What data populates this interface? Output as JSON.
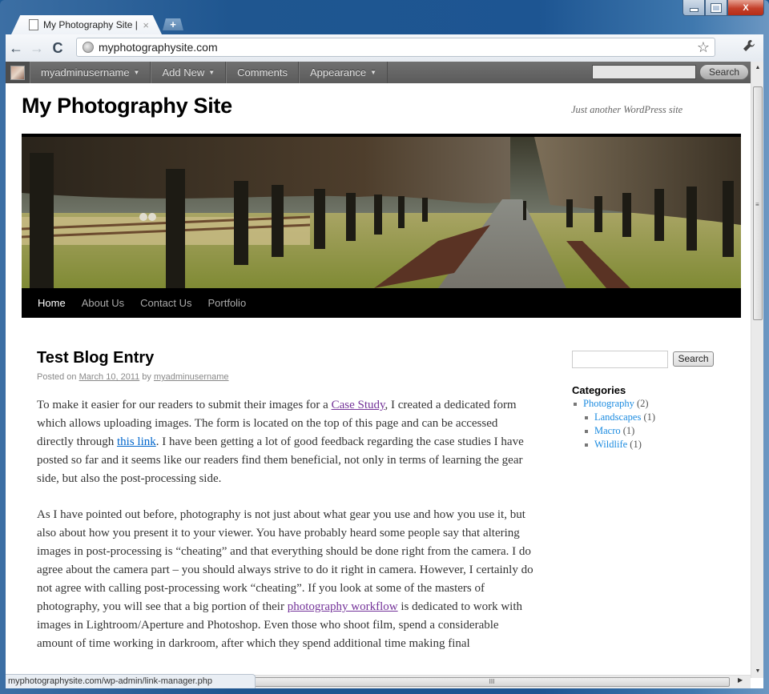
{
  "browser": {
    "tab_title": "My Photography Site | Ju...",
    "tab_close": "×",
    "new_tab": "+",
    "url": "myphotographysite.com",
    "back": "←",
    "forward": "→",
    "reload": "C",
    "bookmark_star": "☆",
    "wrench": "🔧",
    "status_url": "myphotographysite.com/wp-admin/link-manager.php",
    "close_glyph": "X"
  },
  "adminbar": {
    "items": [
      {
        "label": "myadminusername",
        "caret": "▼"
      },
      {
        "label": "Add New",
        "caret": "▼"
      },
      {
        "label": "Comments",
        "caret": ""
      },
      {
        "label": "Appearance",
        "caret": "▼"
      }
    ],
    "search_value": "",
    "search_button": "Search"
  },
  "site": {
    "title": "My Photography Site",
    "description": "Just another WordPress site",
    "menu": [
      {
        "label": "Home",
        "current": true
      },
      {
        "label": "About Us",
        "current": false
      },
      {
        "label": "Contact Us",
        "current": false
      },
      {
        "label": "Portfolio",
        "current": false
      }
    ]
  },
  "post": {
    "title": "Test Blog Entry",
    "meta_prefix": "Posted on",
    "date": "March 10, 2011",
    "meta_by": "by",
    "author": "myadminusername",
    "p1_a": "To make it easier for our readers to submit their images for a ",
    "p1_link1": "Case Study",
    "p1_b": ", I created a dedicated form which allows uploading images. The form is located on the top of this page and can be accessed directly through ",
    "p1_link2": "this link",
    "p1_c": ". I have been getting a lot of good feedback regarding the case studies I have posted so far and it seems like our readers find them beneficial, not only in terms of learning the gear side, but also the post-processing side.",
    "p2_a": "As I have pointed out before, photography is not just about what gear you use and how you use it, but also about how you present it to your viewer. You have probably heard some people say that altering images in post-processing is “cheating” and that everything should be done right from the camera. I do agree about the camera part – you should always strive to do it right in camera. However, I certainly do not agree with calling post-processing work “cheating”. If you look at some of the masters of photography, you will see that a big portion of their ",
    "p2_link": "photography workflow",
    "p2_b": " is dedicated to work with images in Lightroom/Aperture and Photoshop. Even those who shoot film, spend a considerable amount of time working in darkroom, after which they spend additional time making final"
  },
  "sidebar": {
    "search_value": "",
    "search_button": "Search",
    "categories_title": "Categories",
    "categories": [
      {
        "name": "Photography",
        "count": "(2)",
        "child": false
      },
      {
        "name": "Landscapes",
        "count": "(1)",
        "child": true
      },
      {
        "name": "Macro",
        "count": "(1)",
        "child": true
      },
      {
        "name": "Wildlife",
        "count": "(1)",
        "child": true
      }
    ]
  },
  "colors": {
    "visited_link": "#743399",
    "link": "#0066cc",
    "category_link": "#1b8be0",
    "adminbar": "#646464",
    "menu_bar": "#000000"
  }
}
